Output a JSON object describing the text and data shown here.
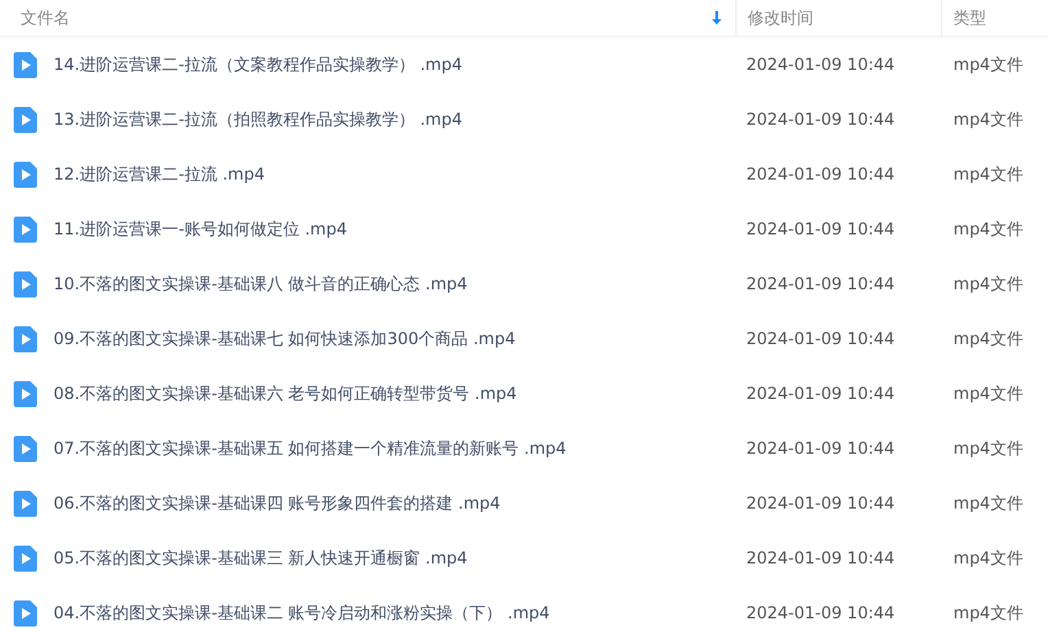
{
  "table": {
    "columns": [
      {
        "label": "文件名",
        "sorted": true
      },
      {
        "label": "修改时间",
        "sorted": false
      },
      {
        "label": "类型",
        "sorted": false
      }
    ],
    "rows": [
      {
        "name": "14.进阶运营课二-拉流（文案教程作品实操教学） .mp4",
        "modified": "2024-01-09 10:44",
        "type": "mp4文件"
      },
      {
        "name": "13.进阶运营课二-拉流（拍照教程作品实操教学） .mp4",
        "modified": "2024-01-09 10:44",
        "type": "mp4文件"
      },
      {
        "name": "12.进阶运营课二-拉流 .mp4",
        "modified": "2024-01-09 10:44",
        "type": "mp4文件"
      },
      {
        "name": "11.进阶运营课一-账号如何做定位 .mp4",
        "modified": "2024-01-09 10:44",
        "type": "mp4文件"
      },
      {
        "name": "10.不落的图文实操课-基础课八 做斗音的正确心态 .mp4",
        "modified": "2024-01-09 10:44",
        "type": "mp4文件"
      },
      {
        "name": "09.不落的图文实操课-基础课七 如何快速添加300个商品 .mp4",
        "modified": "2024-01-09 10:44",
        "type": "mp4文件"
      },
      {
        "name": "08.不落的图文实操课-基础课六 老号如何正确转型带货号 .mp4",
        "modified": "2024-01-09 10:44",
        "type": "mp4文件"
      },
      {
        "name": "07.不落的图文实操课-基础课五 如何搭建一个精准流量的新账号 .mp4",
        "modified": "2024-01-09 10:44",
        "type": "mp4文件"
      },
      {
        "name": "06.不落的图文实操课-基础课四 账号形象四件套的搭建 .mp4",
        "modified": "2024-01-09 10:44",
        "type": "mp4文件"
      },
      {
        "name": "05.不落的图文实操课-基础课三 新人快速开通橱窗 .mp4",
        "modified": "2024-01-09 10:44",
        "type": "mp4文件"
      },
      {
        "name": "04.不落的图文实操课-基础课二 账号冷启动和涨粉实操（下） .mp4",
        "modified": "2024-01-09 10:44",
        "type": "mp4文件"
      }
    ]
  }
}
